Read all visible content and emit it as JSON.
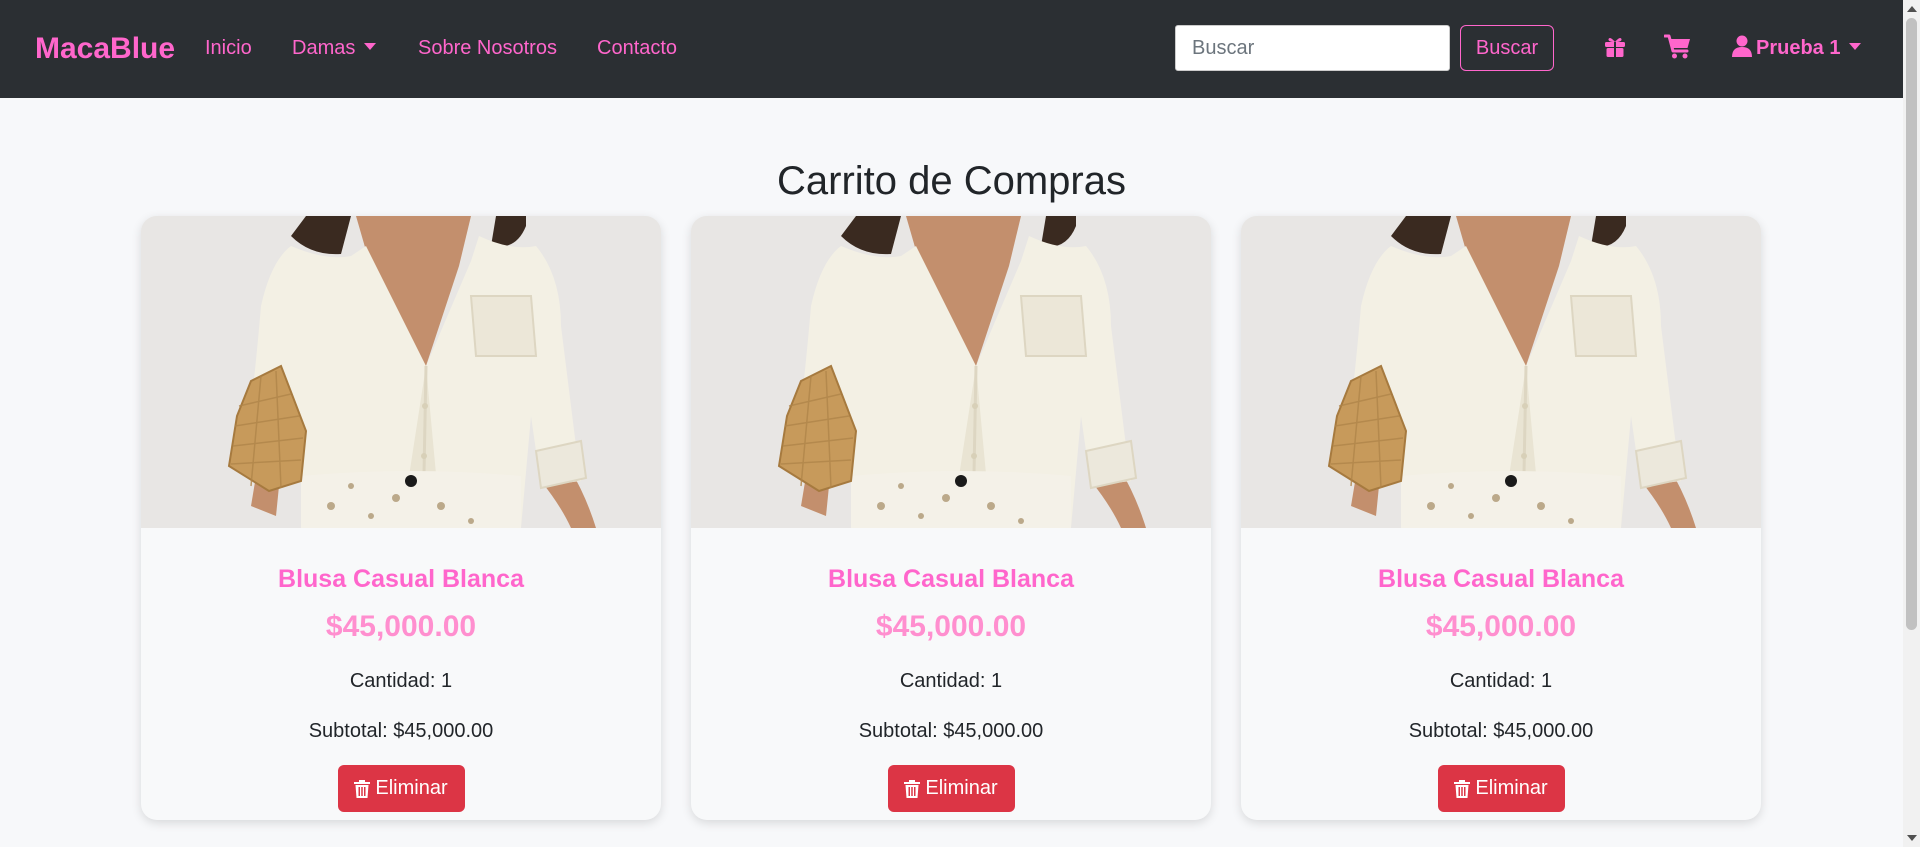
{
  "navbar": {
    "brand": "MacaBlue",
    "links": [
      {
        "label": "Inicio"
      },
      {
        "label": "Damas",
        "dropdown": true
      },
      {
        "label": "Sobre Nosotros"
      },
      {
        "label": "Contacto"
      }
    ],
    "search": {
      "placeholder": "Buscar",
      "value": "",
      "button_label": "Buscar"
    },
    "icons": [
      "gift-icon",
      "cart-icon"
    ],
    "user": {
      "label": "Prueba 1",
      "icon": "user-icon"
    }
  },
  "main": {
    "title": "Carrito de Compras",
    "items": [
      {
        "name": "Blusa Casual Blanca",
        "price": "$45,000.00",
        "quantity": "Cantidad: 1",
        "subtotal": "Subtotal: $45,000.00",
        "delete_label": "Eliminar"
      },
      {
        "name": "Blusa Casual Blanca",
        "price": "$45,000.00",
        "quantity": "Cantidad: 1",
        "subtotal": "Subtotal: $45,000.00",
        "delete_label": "Eliminar"
      },
      {
        "name": "Blusa Casual Blanca",
        "price": "$45,000.00",
        "quantity": "Cantidad: 1",
        "subtotal": "Subtotal: $45,000.00",
        "delete_label": "Eliminar"
      }
    ]
  },
  "colors": {
    "brand_pink": "#ff66cc",
    "price_pink": "#ff8fcf",
    "navbar_bg": "#2b2f33",
    "danger": "#dc3545",
    "page_bg": "#f7f8fa"
  }
}
